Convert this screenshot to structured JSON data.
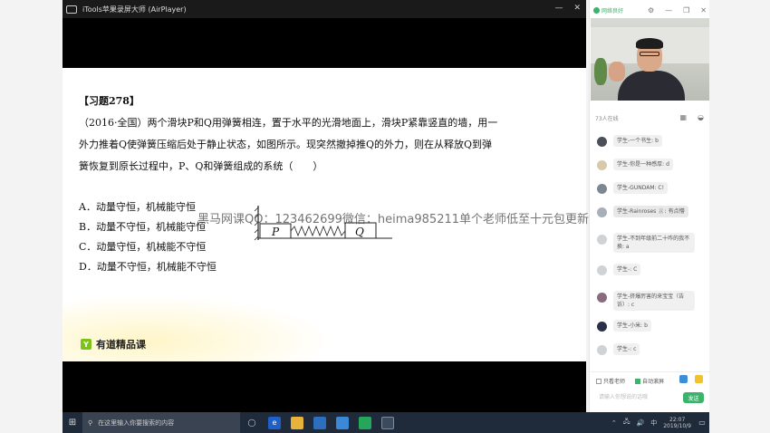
{
  "player": {
    "title": "iTools苹果录屏大师 (AirPlayer)",
    "window_controls": [
      "—",
      "✕"
    ]
  },
  "slide": {
    "heading": "【习题278】",
    "body": "（2016·全国）两个滑块P和Q用弹簧相连，置于水平的光滑地面上，滑块P紧靠竖直的墙，用一外力推着Q使弹簧压缩后处于静止状态，如图所示。现突然撤掉推Q的外力，则在从释放Q到弹簧恢复到原长过程中，P、Q和弹簧组成的系统（　　）",
    "options": [
      "A．动量守恒，机械能守恒",
      "B．动量不守恒，机械能守恒",
      "C．动量守恒，机械能不守恒",
      "D．动量不守恒，机械能不守恒"
    ],
    "figure": {
      "block_p": "P",
      "block_q": "Q"
    },
    "brand_logo": "Y",
    "brand": "有道精品课"
  },
  "watermark": "黑马网课QQ：123462699微信：heima985211单个老师低至十元包更新",
  "panel": {
    "net_status": "网络良好",
    "online_count": "73人在线",
    "messages": [
      {
        "text": "学生-一个书生: b",
        "avatar_color": "#4b4f57"
      },
      {
        "text": "学生-你是一种感厚: d",
        "avatar_color": "#d9c9a8"
      },
      {
        "text": "学生-GUNDAM: C!",
        "avatar_color": "#7d8790"
      },
      {
        "text": "学生-Rainroses 🐰: 有点懵",
        "avatar_color": "#a7b0b8"
      },
      {
        "text": "学生-不到年级前二十咋的我不换: a",
        "avatar_color": "#cfd3d6"
      },
      {
        "text": "学生-: C",
        "avatar_color": "#cfd3d6"
      },
      {
        "text": "学生-挤爆厉害的来宝宝（告诉）: c",
        "avatar_color": "#8a6a7f"
      },
      {
        "text": "学生-小米: b",
        "avatar_color": "#2a2f4a"
      },
      {
        "text": "学生-: c",
        "avatar_color": "#cfd3d6"
      }
    ],
    "only_teacher": "只看老师",
    "auto_scroll": "自动滚屏",
    "compose_placeholder": "请输入你想说的话哦",
    "send": "发送",
    "accent": "#3bb36a"
  },
  "taskbar": {
    "search_placeholder": "在这里输入你要搜索的内容",
    "time": "22:07",
    "date": "2019/10/9",
    "ime": "中",
    "volume_icon": "🔊",
    "network_icon": "🖧"
  }
}
